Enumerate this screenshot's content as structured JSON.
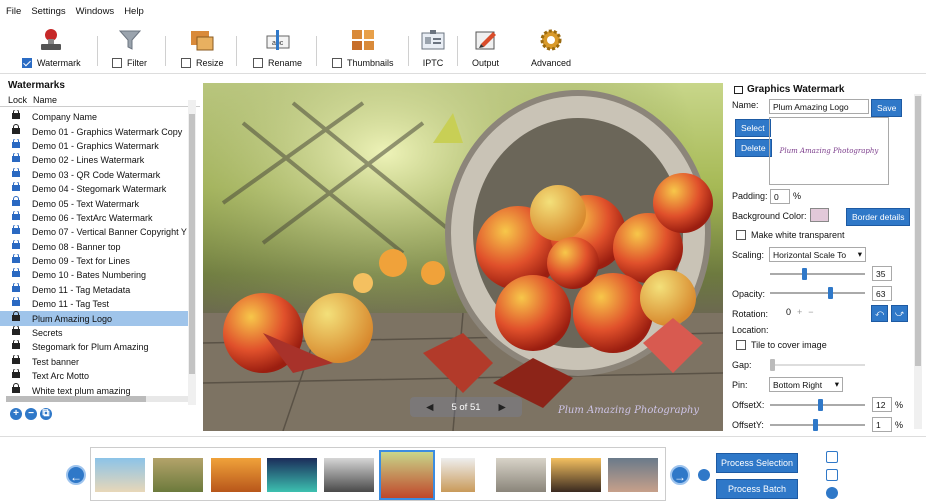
{
  "menu": [
    "File",
    "Settings",
    "Windows",
    "Help"
  ],
  "toolbar": {
    "watermark": {
      "label": "Watermark",
      "checked": true
    },
    "filter": {
      "label": "Filter",
      "checked": false
    },
    "resize": {
      "label": "Resize",
      "checked": false
    },
    "rename": {
      "label": "Rename",
      "checked": false
    },
    "thumbnails": {
      "label": "Thumbnails",
      "checked": false
    },
    "iptc": {
      "label": "IPTC"
    },
    "output": {
      "label": "Output"
    },
    "advanced": {
      "label": "Advanced"
    }
  },
  "watermarks": {
    "title": "Watermarks",
    "col_lock": "Lock",
    "col_name": "Name",
    "items": [
      {
        "name": "Company Name",
        "lock": "black"
      },
      {
        "name": "Demo 01 - Graphics Watermark Copy",
        "lock": "black"
      },
      {
        "name": "Demo 01 - Graphics Watermark",
        "lock": "blue"
      },
      {
        "name": "Demo 02 - Lines Watermark",
        "lock": "blue"
      },
      {
        "name": "Demo 03 - QR Code Watermark",
        "lock": "blue"
      },
      {
        "name": "Demo 04 - Stegomark Watermark",
        "lock": "blue"
      },
      {
        "name": "Demo 05 - Text Watermark",
        "lock": "blue"
      },
      {
        "name": "Demo 06 - TextArc Watermark",
        "lock": "blue"
      },
      {
        "name": "Demo 07 - Vertical Banner Copyright Y",
        "lock": "blue"
      },
      {
        "name": "Demo 08 - Banner top",
        "lock": "blue"
      },
      {
        "name": "Demo 09 - Text for Lines",
        "lock": "blue"
      },
      {
        "name": "Demo 10 - Bates Numbering",
        "lock": "blue"
      },
      {
        "name": "Demo 11 - Tag Metadata",
        "lock": "blue"
      },
      {
        "name": "Demo 11 - Tag Test",
        "lock": "blue"
      },
      {
        "name": "Plum Amazing Logo",
        "lock": "black",
        "selected": true
      },
      {
        "name": "Secrets",
        "lock": "black"
      },
      {
        "name": "Stegomark for Plum Amazing",
        "lock": "black"
      },
      {
        "name": "Test banner",
        "lock": "black"
      },
      {
        "name": "Text Arc Motto",
        "lock": "black"
      },
      {
        "name": "White text plum amazing",
        "lock": "black"
      }
    ]
  },
  "viewer": {
    "counter": "5 of 51",
    "prev": "◀",
    "next": "▶",
    "watermark_text": "Plum Amazing Photography"
  },
  "graphics": {
    "title": "Graphics Watermark",
    "name_label": "Name:",
    "name_value": "Plum Amazing Logo",
    "save": "Save",
    "select": "Select",
    "delete": "Delete",
    "preview_text": "Plum Amazing Photography",
    "padding_label": "Padding:",
    "padding_value": "0",
    "padding_unit": "%",
    "bg_label": "Background Color:",
    "bg_color": "#e2c9d9",
    "border_details": "Border details",
    "make_white": "Make white transparent",
    "scaling_label": "Scaling:",
    "scaling_value": "Horizontal Scale To",
    "scaling_num": "35",
    "opacity_label": "Opacity:",
    "opacity_value": "63",
    "rotation_label": "Rotation:",
    "rotation_value": "0",
    "location_label": "Location:",
    "tile_label": "Tile to cover image",
    "gap_label": "Gap:",
    "pin_label": "Pin:",
    "pin_value": "Bottom Right",
    "offsetx_label": "OffsetX:",
    "offsetx_value": "12",
    "offsety_label": "OffsetY:",
    "offsety_value": "1",
    "pct": "%"
  },
  "bottom": {
    "process_selection": "Process Selection",
    "process_batch": "Process Batch"
  },
  "colors": {
    "accent": "#2f78c8",
    "selected_row": "#9fc4ea"
  }
}
